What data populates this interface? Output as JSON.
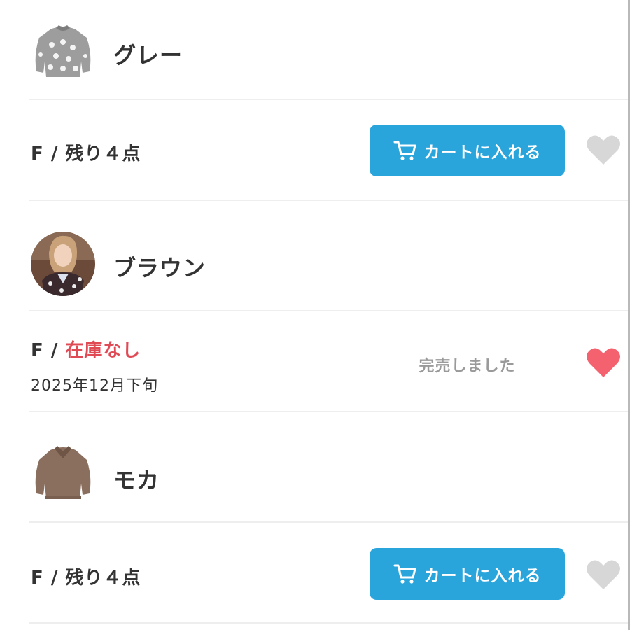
{
  "variants": [
    {
      "color_name": "グレー",
      "thumbnail": "gray-sweater-thumbnail",
      "size_label": "F / ",
      "stock_text": "残り４点",
      "cart_label": "カートに入れる",
      "favorite": false
    },
    {
      "color_name": "ブラウン",
      "thumbnail": "model-wearing-brown-sweater-thumbnail",
      "size_label": "F / ",
      "stock_text": "在庫なし",
      "restock_date": "2025年12月下旬",
      "sold_out_label": "完売しました",
      "favorite": true
    },
    {
      "color_name": "モカ",
      "thumbnail": "mocha-sweater-thumbnail",
      "size_label": "F / ",
      "stock_text": "残り４点",
      "cart_label": "カートに入れる",
      "favorite": false
    }
  ],
  "colors": {
    "cart_button": "#2aa5dc",
    "out_of_stock_text": "#e04a55",
    "heart_inactive": "#d7d7d7",
    "heart_active": "#f4626f",
    "sold_out_text": "#9a9a9a",
    "divider": "#eeeeee"
  },
  "icons": {
    "cart": "cart-icon",
    "favorite": "heart-icon"
  }
}
